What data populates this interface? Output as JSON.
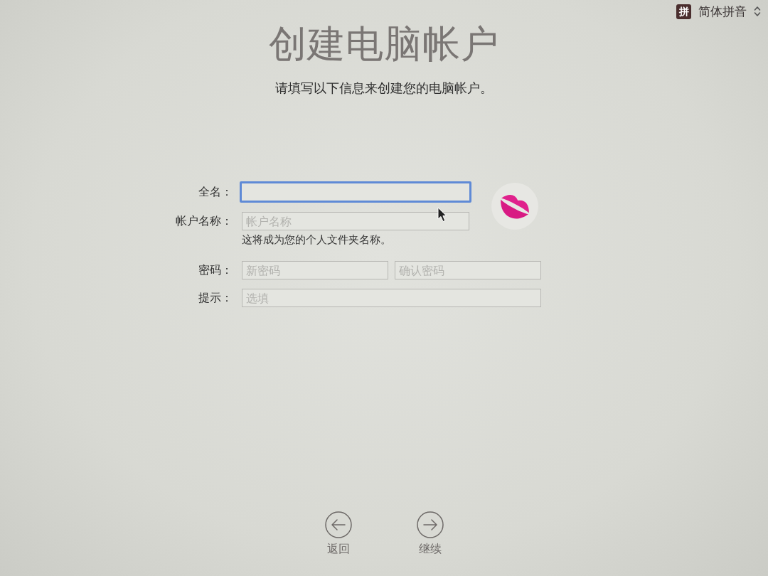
{
  "input_menu": {
    "badge": "拼",
    "label": "简体拼音"
  },
  "title": "创建电脑帐户",
  "subtitle": "请填写以下信息来创建您的电脑帐户。",
  "form": {
    "rows": [
      {
        "label": "全名：",
        "fields": [
          {
            "focused": true
          }
        ]
      },
      {
        "label": "帐户名称：",
        "fields": [
          {
            "placeholder": "帐户名称",
            "focused": false
          }
        ],
        "note": "这将成为您的个人文件夹名称。"
      },
      {
        "label": "密码：",
        "fields": [
          {
            "placeholder": "新密码",
            "focused": false
          },
          {
            "placeholder": "确认密码",
            "focused": false
          }
        ]
      },
      {
        "label": "提示：",
        "fields": [
          {
            "placeholder": "选填",
            "focused": false
          }
        ]
      }
    ]
  },
  "buttons": [
    {
      "kind": "back",
      "label": "返回"
    },
    {
      "kind": "continue",
      "label": "继续"
    }
  ]
}
